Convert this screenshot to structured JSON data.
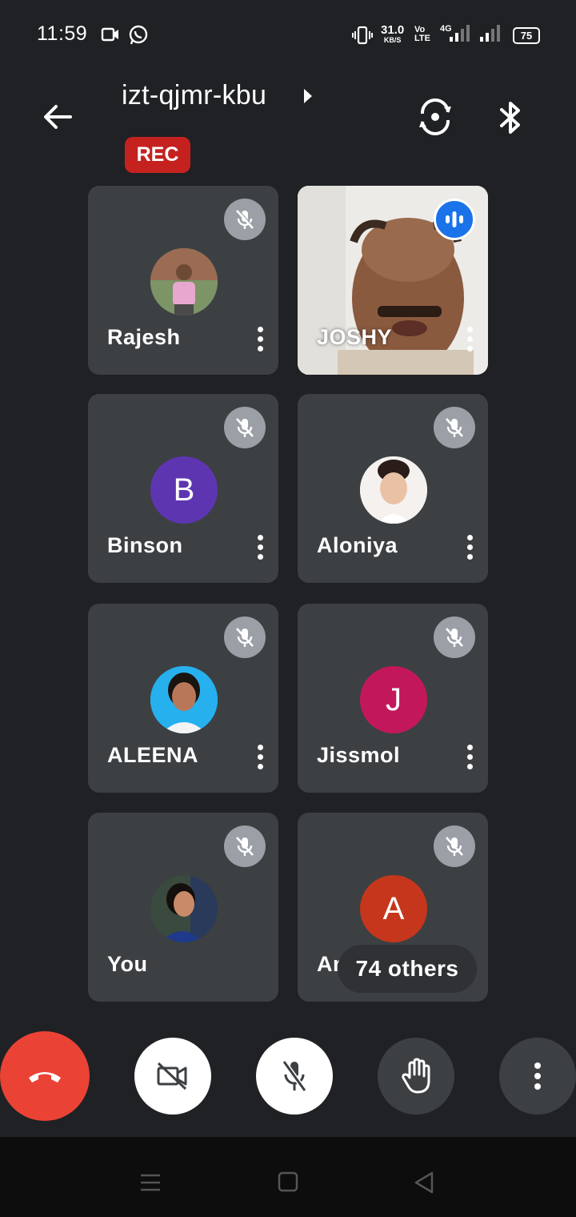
{
  "status_bar": {
    "time": "11:59",
    "net_speed_value": "31.0",
    "net_speed_unit": "KB/S",
    "volte": "Vo LTE",
    "network": "4G",
    "battery": "75"
  },
  "header": {
    "meeting_code": "izt-qjmr-kbu",
    "rec_label": "REC"
  },
  "participants": [
    {
      "name": "Rajesh",
      "avatar_letter": "",
      "avatar_color": "#6b7b5a"
    },
    {
      "name": "JOSHY",
      "avatar_letter": "",
      "avatar_color": "#1a73e8"
    },
    {
      "name": "Binson",
      "avatar_letter": "B",
      "avatar_color": "#5e35b1"
    },
    {
      "name": "Aloniya",
      "avatar_letter": "",
      "avatar_color": "#f1ece8"
    },
    {
      "name": "ALEENA",
      "avatar_letter": "",
      "avatar_color": "#29b6f6"
    },
    {
      "name": "Jissmol",
      "avatar_letter": "J",
      "avatar_color": "#c2185b"
    },
    {
      "name": "You",
      "avatar_letter": "",
      "avatar_color": "#2c3440"
    },
    {
      "name": "Anjay",
      "avatar_letter": "A",
      "avatar_color": "#c5361c"
    }
  ],
  "others_label": "74 others",
  "colors": {
    "background": "#202124",
    "tile": "#3c4043",
    "end_call": "#ea4335",
    "rec": "#c5221f"
  }
}
